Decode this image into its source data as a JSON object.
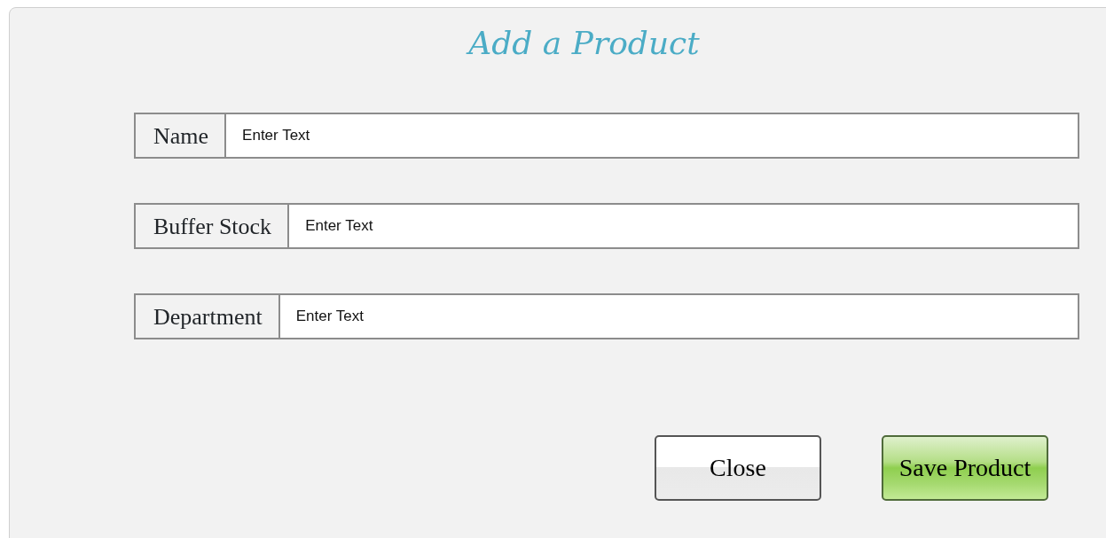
{
  "dialog": {
    "title": "Add a Product"
  },
  "fields": [
    {
      "label": "Name",
      "placeholder": "Enter Text"
    },
    {
      "label": "Buffer Stock",
      "placeholder": "Enter Text"
    },
    {
      "label": "Department",
      "placeholder": "Enter Text"
    }
  ],
  "buttons": [
    {
      "label": "Close",
      "kind": "plain"
    },
    {
      "label": "Save Product",
      "kind": "primary"
    }
  ]
}
